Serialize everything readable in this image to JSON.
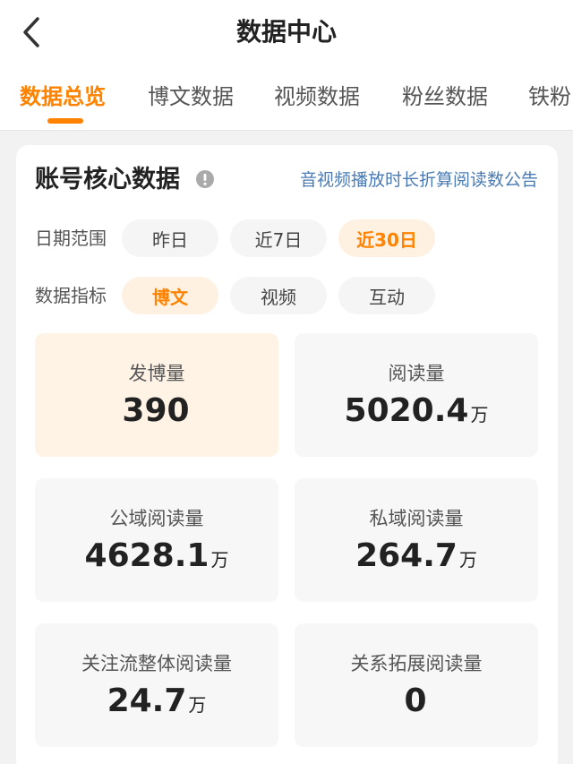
{
  "header": {
    "title": "数据中心",
    "back_icon": "chevron-left-icon"
  },
  "tabs": [
    {
      "label": "数据总览",
      "active": true
    },
    {
      "label": "博文数据",
      "active": false
    },
    {
      "label": "视频数据",
      "active": false
    },
    {
      "label": "粉丝数据",
      "active": false
    },
    {
      "label": "铁粉",
      "active": false
    }
  ],
  "colors": {
    "accent": "#ff8200",
    "link": "#4a7bb5",
    "active_chip_bg": "#fff1e2",
    "active_tile_bg": "#fff3e6"
  },
  "card": {
    "title": "账号核心数据",
    "info_icon": "info-circle-icon",
    "notice_link": "音视频播放时长折算阅读数公告",
    "date_range": {
      "label": "日期范围",
      "options": [
        "昨日",
        "近7日",
        "近30日"
      ],
      "selected": "近30日"
    },
    "metric_type": {
      "label": "数据指标",
      "options": [
        "博文",
        "视频",
        "互动"
      ],
      "selected": "博文"
    },
    "tiles": [
      {
        "label": "发博量",
        "value": "390",
        "unit": "",
        "active": true
      },
      {
        "label": "阅读量",
        "value": "5020.4",
        "unit": "万",
        "active": false
      },
      {
        "label": "公域阅读量",
        "value": "4628.1",
        "unit": "万",
        "active": false
      },
      {
        "label": "私域阅读量",
        "value": "264.7",
        "unit": "万",
        "active": false
      },
      {
        "label": "关注流整体阅读量",
        "value": "24.7",
        "unit": "万",
        "active": false
      },
      {
        "label": "关系拓展阅读量",
        "value": "0",
        "unit": "",
        "active": false
      }
    ]
  }
}
